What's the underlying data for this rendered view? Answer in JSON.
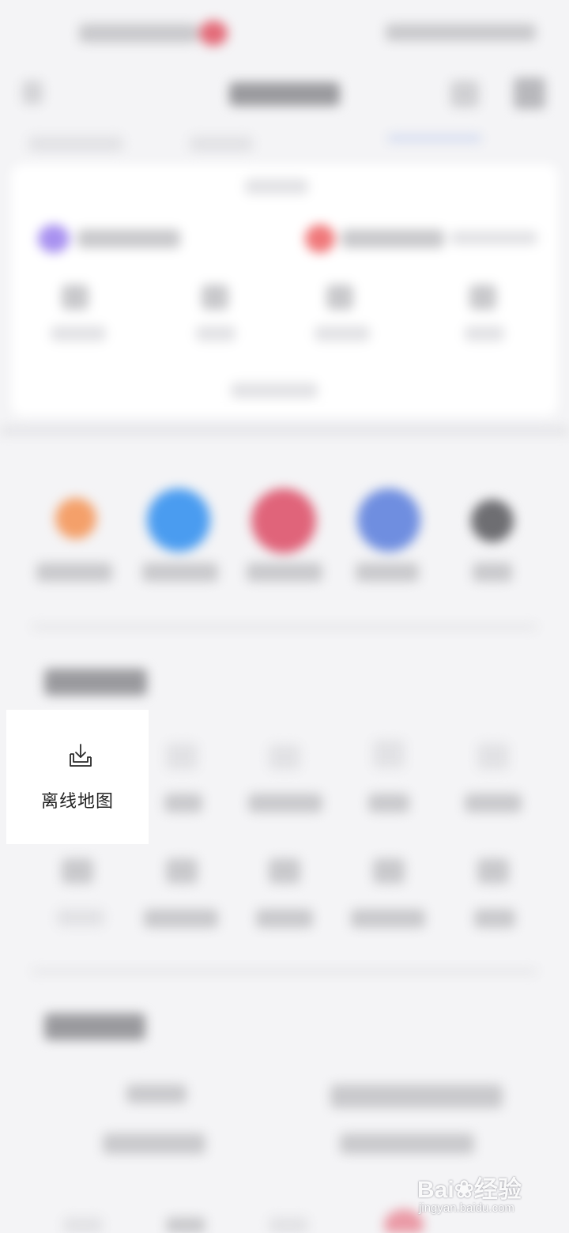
{
  "focused_item": {
    "label": "离线地图",
    "icon": "download-tray-icon"
  },
  "watermark": {
    "brand": "Bai",
    "brand_suffix": "经验",
    "url": "jingyan.baidu.com"
  },
  "colors": {
    "orange_tool": "#f4a06a",
    "blue_tool": "#4a9cf0",
    "red_tool": "#e0647a",
    "indigo_tool": "#6f8ee0",
    "gray_tool": "#6e6e72",
    "purple_badge": "#a891f0",
    "red_badge": "#f0787a"
  }
}
